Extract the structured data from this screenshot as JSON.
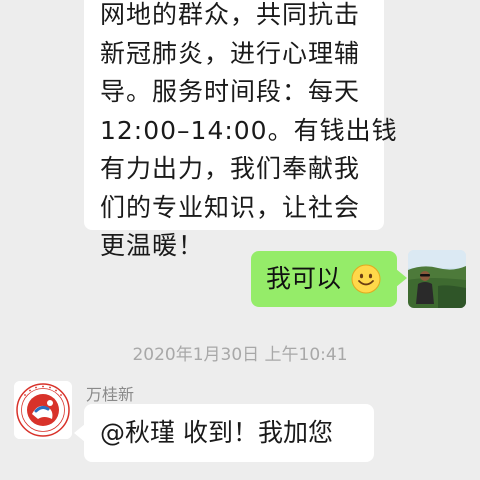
{
  "messages": {
    "incoming_top": {
      "lines": [
        "网地的群众，共同抗击",
        "新冠肺炎，进行心理辅",
        "导。服务时间段：每天",
        "12:00–14:00。有钱出钱",
        "有力出力，我们奉献我",
        "们的专业知识，让社会",
        "更温暖！"
      ]
    },
    "outgoing": {
      "text": "我可以",
      "emoji": "smile-emoji"
    },
    "timestamp": "2020年1月30日 上午10:41",
    "incoming_bottom": {
      "sender": "万桂新",
      "text": "@秋瑾 收到！我加您"
    }
  },
  "colors": {
    "background": "#ededed",
    "outgoing_bubble": "#95ec69",
    "incoming_bubble": "#ffffff",
    "logo_red": "#d8322a",
    "logo_blue": "#2a6fc0"
  }
}
